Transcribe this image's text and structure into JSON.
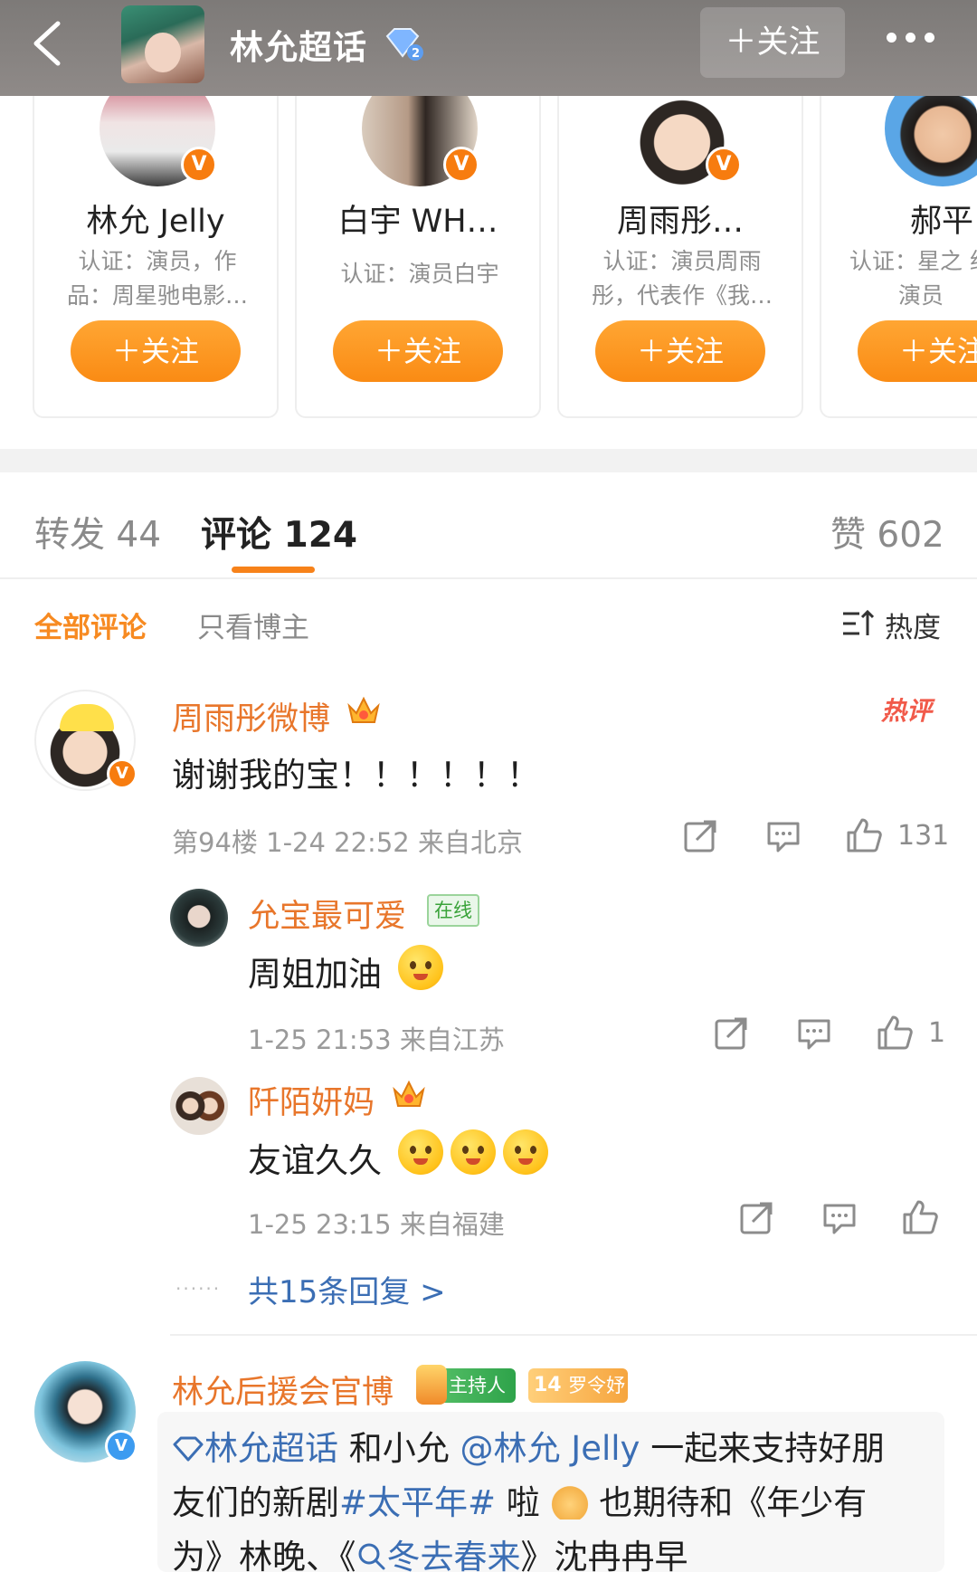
{
  "header": {
    "title": "林允超话",
    "follow_label": "＋关注"
  },
  "recommend_cards": [
    {
      "name": "林允 Jelly",
      "desc": "认证：演员，作品：周星驰电影…",
      "follow": "＋关注"
    },
    {
      "name": "白宇 WH…",
      "desc": "认证：演员白宇",
      "follow": "＋关注"
    },
    {
      "name": "周雨彤…",
      "desc": "认证：演员周雨彤，代表作《我…",
      "follow": "＋关注"
    },
    {
      "name": "郝平",
      "desc": "认证：星之 约演员",
      "follow": "＋关注"
    }
  ],
  "tabs": {
    "repost": "转发 44",
    "comments": "评论 124",
    "likes": "赞 602"
  },
  "filters": {
    "all": "全部评论",
    "blogger_only": "只看博主",
    "sort": "热度"
  },
  "comments": [
    {
      "name": "周雨彤微博",
      "hot": "热评",
      "text": "谢谢我的宝！！！！！！",
      "meta": "第94楼 1-24 22:52 来自北京",
      "likes": "131",
      "replies": [
        {
          "name": "允宝最可爱",
          "status": "在线",
          "text": "周姐加油",
          "meta": "1-25 21:53 来自江苏",
          "likes": "1"
        },
        {
          "name": "阡陌妍妈",
          "text": "友谊久久",
          "meta": "1-25 23:15 来自福建",
          "likes": ""
        }
      ],
      "more_replies": "共15条回复 >"
    },
    {
      "name": "林允后援会官博",
      "host_tag": "主持人",
      "level": "14",
      "level_label": "罗令妤",
      "line1_link1": "林允超话",
      "line1_mid": " 和小允 ",
      "line1_link2": "@林允 Jelly",
      "line1_tail": " 一起来支持好朋",
      "line2_head": "友们的新剧",
      "line2_tag": "#太平年#",
      "line2_mid": " 啦 ",
      "line2_tail": " 也期待和《年少有",
      "line3_head": "为》林晚、《",
      "line3_link": "冬去春来",
      "line3_tail": "》沈冉冉早"
    }
  ],
  "colors": {
    "accent_orange": "#f7821a",
    "link_blue": "#3b6eb4",
    "name_orange": "#e8762b",
    "header_bg": "#8a8583"
  },
  "icons": [
    "back-icon",
    "diamond-icon",
    "more-icon",
    "sort-icon",
    "share-icon",
    "comment-icon",
    "like-icon",
    "crown-icon",
    "verified-badge-icon"
  ]
}
